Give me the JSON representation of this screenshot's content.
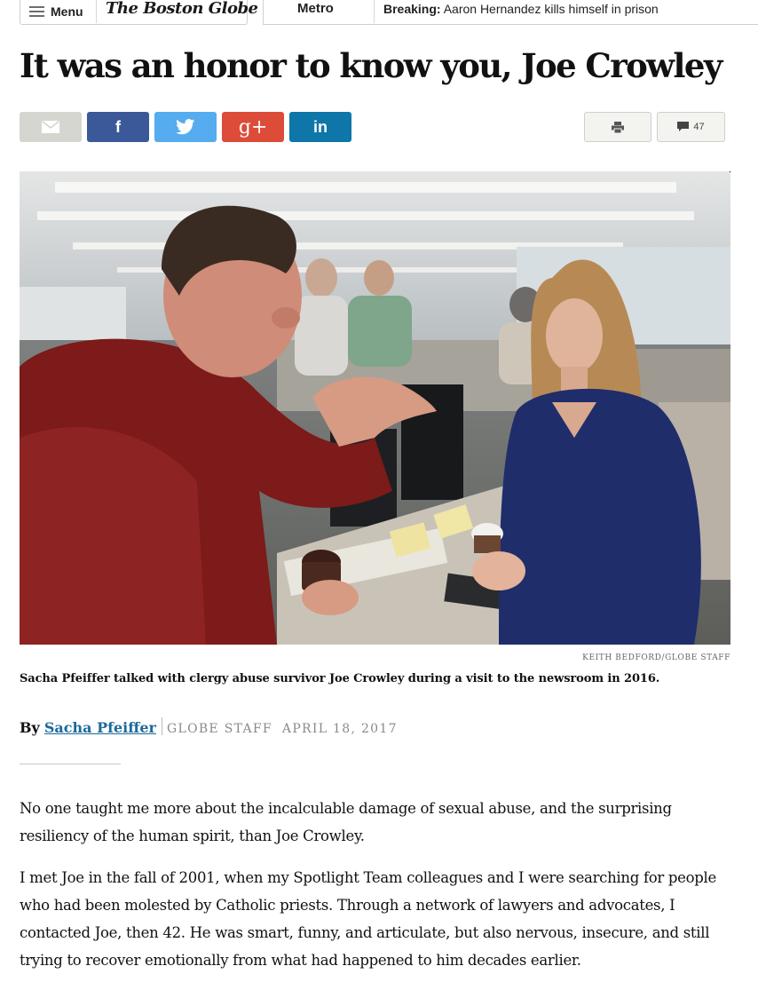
{
  "nav": {
    "menu_label": "Menu",
    "logo_text": "The Boston Globe",
    "section": "Metro",
    "breaking_label": "Breaking:",
    "breaking_text": "Aaron Hernandez kills himself in prison"
  },
  "article": {
    "headline": "It was an honor to know you, Joe Crowley",
    "share": {
      "email_icon": "envelope-icon",
      "facebook_glyph": "f",
      "twitter_icon": "twitter-bird-icon",
      "gplus_glyph": "g+",
      "linkedin_glyph": "in",
      "print_icon": "printer-icon",
      "comments_icon": "speech-bubble-icon",
      "comment_count": "47"
    },
    "photo": {
      "credit": "KEITH BEDFORD/GLOBE STAFF",
      "caption": "Sacha Pfeiffer talked with clergy abuse survivor Joe Crowley during a visit to the newsroom in 2016."
    },
    "byline": {
      "by": "By",
      "author": "Sacha Pfeiffer",
      "affiliation": "GLOBE STAFF",
      "date": "APRIL 18, 2017"
    },
    "paragraphs": [
      "No one taught me more about the incalculable damage of sexual abuse, and the surprising resiliency of the human spirit, than Joe Crowley.",
      "I met Joe in the fall of 2001, when my Spotlight Team colleagues and I were searching for people who had been molested by Catholic priests. Through a network of lawyers and advocates, I contacted Joe, then 42. He was smart, funny, and articulate, but also nervous, insecure, and still trying to recover emotionally from what had happened to him decades earlier."
    ]
  },
  "colors": {
    "facebook": "#3b5998",
    "twitter": "#55acee",
    "gplus": "#dd4b39",
    "linkedin": "#0e76a8",
    "email": "#d6d6d0",
    "author_link": "#1a6a9b"
  }
}
